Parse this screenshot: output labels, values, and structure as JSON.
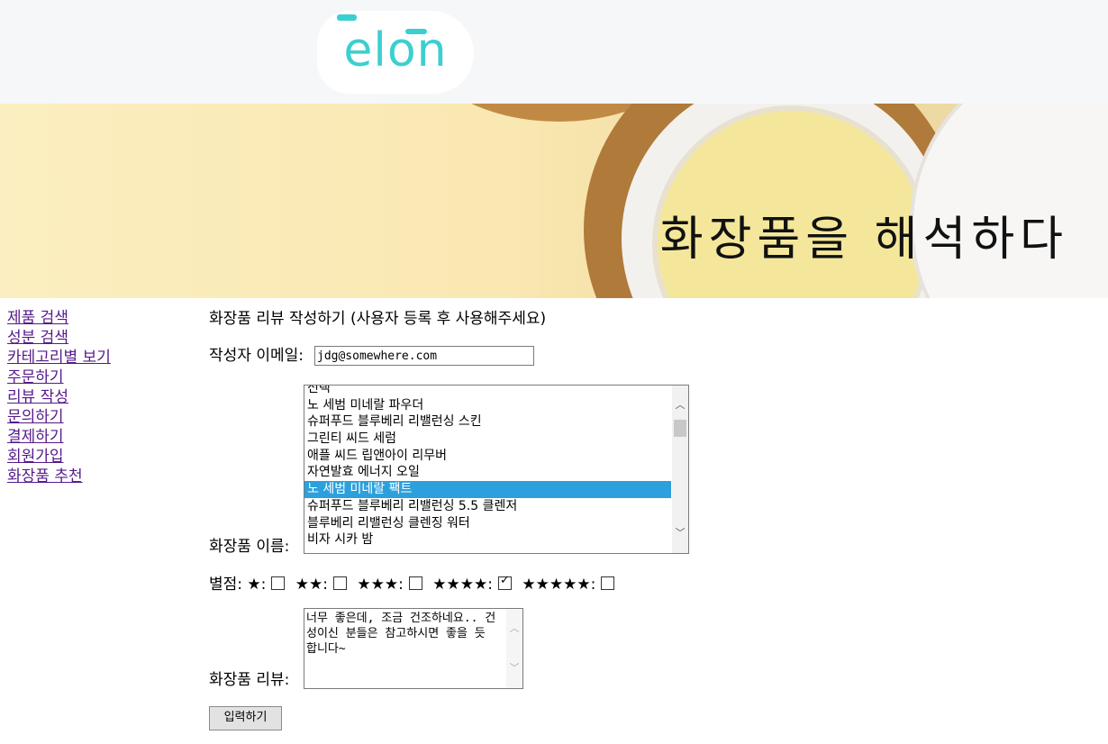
{
  "header": {
    "logo_text": "elon"
  },
  "banner": {
    "title": "화장품을 해석하다"
  },
  "sidebar": {
    "items": [
      {
        "label": "제품 검색"
      },
      {
        "label": "성분 검색"
      },
      {
        "label": "카테고리별 보기"
      },
      {
        "label": "주문하기"
      },
      {
        "label": "리뷰 작성"
      },
      {
        "label": "문의하기"
      },
      {
        "label": "결제하기"
      },
      {
        "label": "회원가입"
      },
      {
        "label": "화장품 추천"
      }
    ]
  },
  "form": {
    "heading": "화장품 리뷰 작성하기 (사용자 등록 후 사용해주세요)",
    "email_label": "작성자 이메일:",
    "email_value": "jdg@somewhere.com",
    "product_label": "화장품 이름:",
    "product_options": [
      "선택",
      "노 세범 미네랄 파우더",
      "슈퍼푸드 블루베리 리밸런싱 스킨",
      "그린티 씨드 세럼",
      "애플 씨드 립앤아이 리무버",
      "자연발효 에너지 오일",
      "노 세범 미네랄 팩트",
      "슈퍼푸드 블루베리 리밸런싱 5.5 클렌저",
      "블루베리 리밸런싱 클렌징 워터",
      "비자 시카 밤"
    ],
    "selected_option": "노 세범 미네랄 팩트",
    "rating_label": "별점:",
    "rating_options": [
      {
        "label": "★:",
        "checked": false
      },
      {
        "label": "★★:",
        "checked": false
      },
      {
        "label": "★★★:",
        "checked": false
      },
      {
        "label": "★★★★:",
        "checked": true
      },
      {
        "label": "★★★★★:",
        "checked": false
      }
    ],
    "review_label": "화장품 리뷰:",
    "review_text": "너무 좋은데, 조금 건조하네요.. 건성이신 분들은 참고하시면 좋을 듯 합니다~",
    "submit_label": "입력하기"
  },
  "colors": {
    "logo": "#3ccfcf",
    "selection": "#2ca0dc",
    "link": "#551a8b"
  }
}
